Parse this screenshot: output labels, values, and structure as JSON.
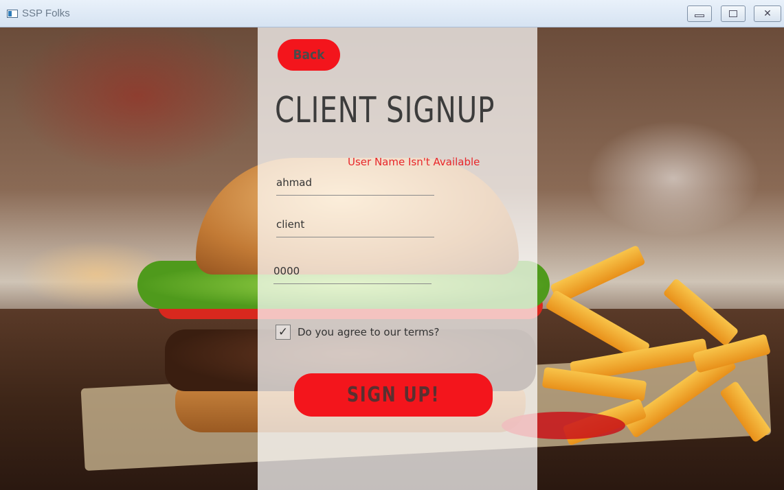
{
  "window": {
    "title": "SSP Folks",
    "controls": [
      "minimize",
      "maximize",
      "close"
    ]
  },
  "form": {
    "back_label": "Back",
    "title": "CLIENT SIGNUP",
    "error_message": "User Name Isn't Available",
    "username_value": "ahmad",
    "account_type_value": "client",
    "code_value": "0000",
    "terms_label": "Do you agree to our terms?",
    "terms_checked": true,
    "submit_label": "SIGN UP!"
  },
  "colors": {
    "accent": "#f3151c",
    "error": "#e8262a",
    "text": "#3c3c3c"
  }
}
